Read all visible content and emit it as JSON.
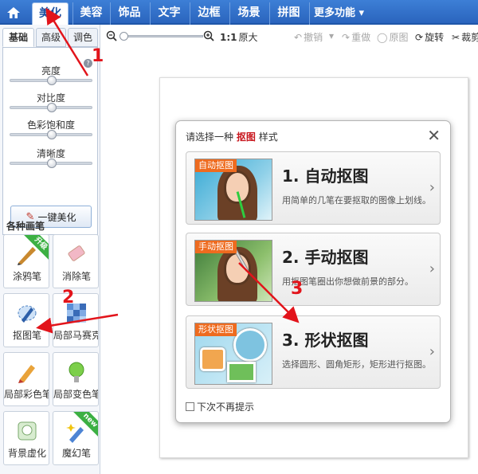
{
  "nav": {
    "home_icon": "home-icon",
    "tabs": [
      {
        "label": "美化",
        "active": true
      },
      {
        "label": "美容"
      },
      {
        "label": "饰品"
      },
      {
        "label": "文字"
      },
      {
        "label": "边框"
      },
      {
        "label": "场景"
      },
      {
        "label": "拼图"
      },
      {
        "label": "更多功能 ▾"
      }
    ]
  },
  "left_panel": {
    "subtabs": [
      "基础",
      "高级",
      "调色"
    ],
    "sliders": [
      {
        "label": "亮度",
        "value": 0.5
      },
      {
        "label": "对比度",
        "value": 0.5
      },
      {
        "label": "色彩饱和度",
        "value": 0.5
      },
      {
        "label": "清晰度",
        "value": 0.5
      }
    ],
    "onekey_label": "一键美化",
    "brushes_title": "各种画笔",
    "brushes": [
      {
        "label": "涂鸦笔",
        "icon": "doodle-brush-icon",
        "badge": "升级"
      },
      {
        "label": "消除笔",
        "icon": "eraser-icon"
      },
      {
        "label": "抠图笔",
        "icon": "cutout-pen-icon"
      },
      {
        "label": "局部马赛克",
        "icon": "mosaic-icon"
      },
      {
        "label": "局部彩色笔",
        "icon": "color-brush-icon"
      },
      {
        "label": "局部变色笔",
        "icon": "color-change-icon"
      },
      {
        "label": "背景虚化",
        "icon": "blur-background-icon"
      },
      {
        "label": "魔幻笔",
        "icon": "magic-pen-icon",
        "badge": "new"
      }
    ]
  },
  "toolbar": {
    "zoom_ratio": "1:1",
    "original_size": "原大",
    "undo": "撤销",
    "redo": "重做",
    "original_image": "原图",
    "rotate": "旋转",
    "crop": "裁剪"
  },
  "dialog": {
    "title_prefix": "请选择一种",
    "title_highlight": "抠图",
    "title_suffix": "样式",
    "options": [
      {
        "tag": "自动抠图",
        "title": "1. 自动抠图",
        "desc": "用简单的几笔在要抠取的图像上划线。"
      },
      {
        "tag": "手动抠图",
        "title": "2. 手动抠图",
        "desc": "用抠图笔圈出你想做前景的部分。"
      },
      {
        "tag": "形状抠图",
        "title": "3. 形状抠图",
        "desc": "选择圆形、圆角矩形，矩形进行抠图。"
      }
    ],
    "checkbox_label": "下次不再提示"
  },
  "annotations": [
    "1",
    "2",
    "3"
  ],
  "colors": {
    "accent": "#2a64bd",
    "annotation": "#e2141b",
    "tag": "#ee6b1f"
  }
}
